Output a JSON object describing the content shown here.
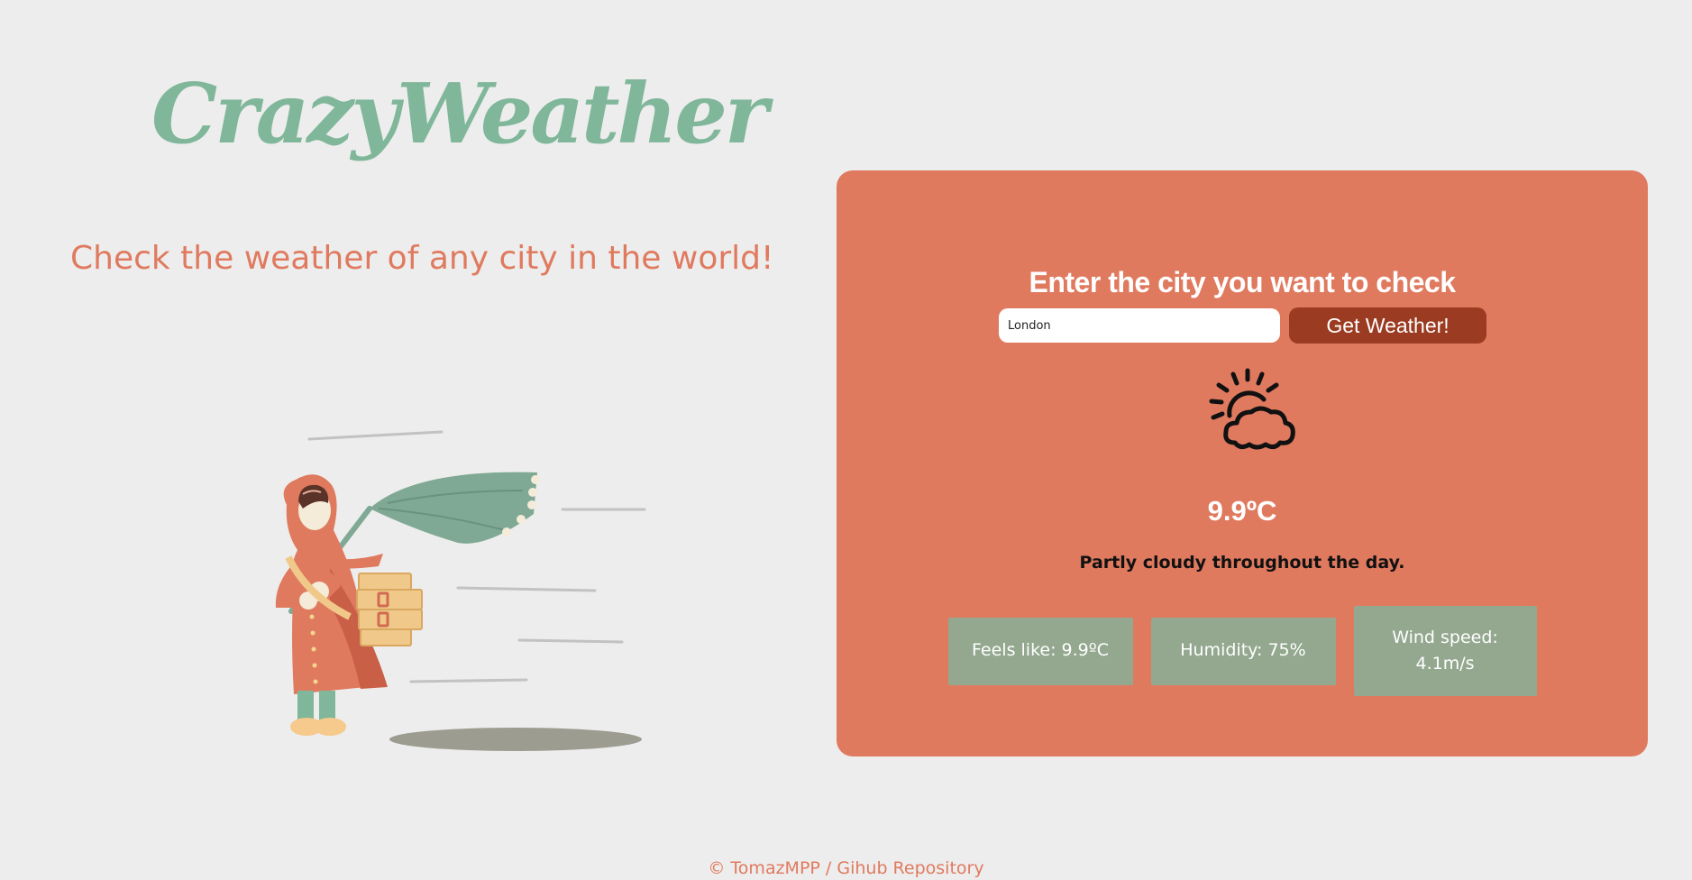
{
  "header": {
    "title": "CrazyWeather",
    "tagline": "Check the weather of any city in the world!"
  },
  "panel": {
    "heading": "Enter the city you want to check",
    "input_value": "London",
    "button_label": "Get Weather!",
    "weather_icon": "partly-cloudy-icon",
    "temperature": "9.9ºC",
    "description": "Partly cloudy throughout the day.",
    "stats": {
      "feels_like": "Feels like: 9.9ºC",
      "humidity": "Humidity: 75%",
      "wind_label": "Wind speed:",
      "wind_value": "4.1m/s"
    }
  },
  "footer": {
    "author": "© TomazMPP",
    "separator": "/",
    "repo_link": "Gihub Repository"
  },
  "colors": {
    "background": "#ededed",
    "brand_green": "#80b79a",
    "accent_coral": "#e07a5f",
    "button_dark": "#9b3b21",
    "stat_card": "#93a88f"
  }
}
